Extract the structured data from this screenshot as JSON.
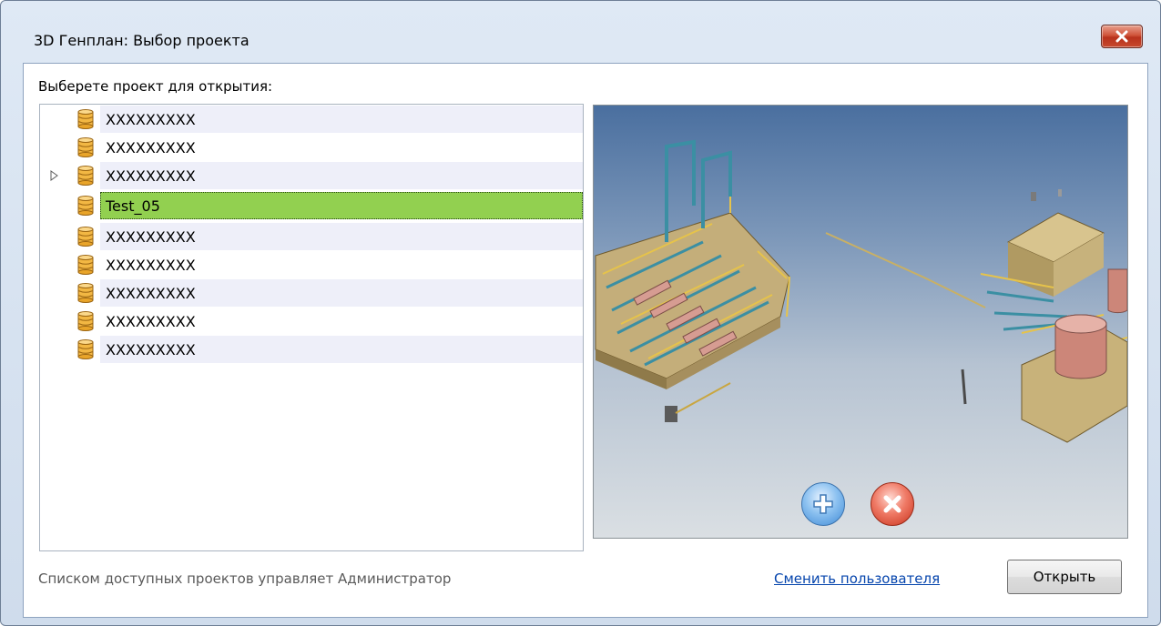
{
  "window": {
    "title": "3D Генплан: Выбор проекта",
    "close_icon": "close-icon"
  },
  "prompt": "Выберете проект для открытия:",
  "projects": [
    {
      "label": "XXXXXXXXX",
      "icon": "database-icon"
    },
    {
      "label": "XXXXXXXXX",
      "icon": "database-icon"
    },
    {
      "label": "XXXXXXXXX",
      "icon": "database-icon",
      "has_children": true
    },
    {
      "label": "Test_05",
      "icon": "database-icon",
      "selected": true
    },
    {
      "label": "XXXXXXXXX",
      "icon": "database-icon"
    },
    {
      "label": "XXXXXXXXX",
      "icon": "database-icon"
    },
    {
      "label": "XXXXXXXXX",
      "icon": "database-icon"
    },
    {
      "label": "XXXXXXXXX",
      "icon": "database-icon"
    },
    {
      "label": "XXXXXXXXX",
      "icon": "database-icon"
    }
  ],
  "preview": {
    "add_icon": "plus-icon",
    "remove_icon": "remove-icon"
  },
  "footer": {
    "admin_note": "Списком доступных проектов управляет Администратор",
    "switch_user": "Сменить пользователя",
    "open_button": "Открыть"
  },
  "colors": {
    "selection": "#92d050",
    "alt_row": "#eeeff9",
    "link": "#0645ad",
    "close_red": "#c7492e"
  }
}
